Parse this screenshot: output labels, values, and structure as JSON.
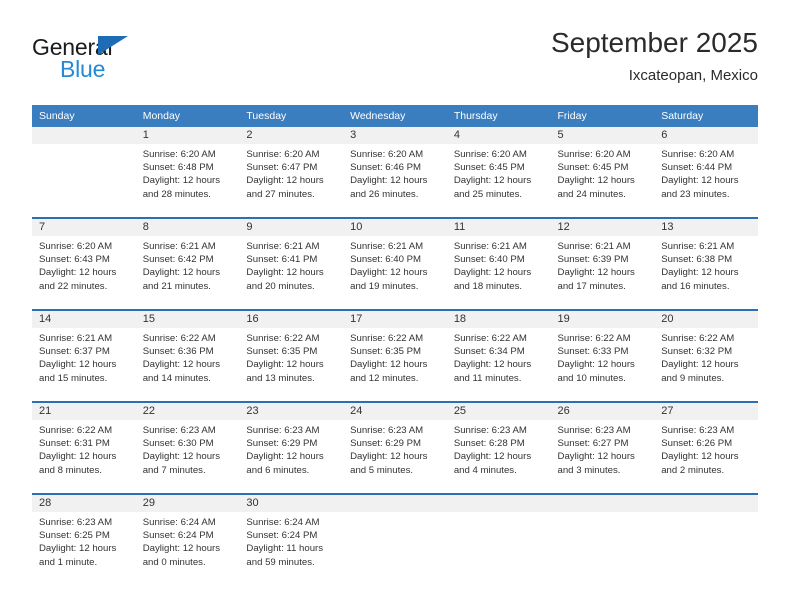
{
  "brand": {
    "name_top": "General",
    "name_bottom": "Blue",
    "triangle_color": "#1d6cb5",
    "blue_color": "#2489d6"
  },
  "header": {
    "title": "September 2025",
    "subtitle": "Ixcateopan, Mexico"
  },
  "theme": {
    "header_bar": "#3a7ebf",
    "week_divider": "#2c6fb5",
    "daynum_bg": "#f1f1f1",
    "text": "#333333"
  },
  "labels": {
    "sunrise": "Sunrise:",
    "sunset": "Sunset:",
    "daylight": "Daylight:"
  },
  "weekdays": [
    "Sunday",
    "Monday",
    "Tuesday",
    "Wednesday",
    "Thursday",
    "Friday",
    "Saturday"
  ],
  "weeks": [
    [
      {
        "day": "",
        "sunrise": "",
        "sunset": "",
        "daylight_line1": "",
        "daylight_line2": ""
      },
      {
        "day": "1",
        "sunrise": "Sunrise: 6:20 AM",
        "sunset": "Sunset: 6:48 PM",
        "daylight_line1": "Daylight: 12 hours",
        "daylight_line2": "and 28 minutes."
      },
      {
        "day": "2",
        "sunrise": "Sunrise: 6:20 AM",
        "sunset": "Sunset: 6:47 PM",
        "daylight_line1": "Daylight: 12 hours",
        "daylight_line2": "and 27 minutes."
      },
      {
        "day": "3",
        "sunrise": "Sunrise: 6:20 AM",
        "sunset": "Sunset: 6:46 PM",
        "daylight_line1": "Daylight: 12 hours",
        "daylight_line2": "and 26 minutes."
      },
      {
        "day": "4",
        "sunrise": "Sunrise: 6:20 AM",
        "sunset": "Sunset: 6:45 PM",
        "daylight_line1": "Daylight: 12 hours",
        "daylight_line2": "and 25 minutes."
      },
      {
        "day": "5",
        "sunrise": "Sunrise: 6:20 AM",
        "sunset": "Sunset: 6:45 PM",
        "daylight_line1": "Daylight: 12 hours",
        "daylight_line2": "and 24 minutes."
      },
      {
        "day": "6",
        "sunrise": "Sunrise: 6:20 AM",
        "sunset": "Sunset: 6:44 PM",
        "daylight_line1": "Daylight: 12 hours",
        "daylight_line2": "and 23 minutes."
      }
    ],
    [
      {
        "day": "7",
        "sunrise": "Sunrise: 6:20 AM",
        "sunset": "Sunset: 6:43 PM",
        "daylight_line1": "Daylight: 12 hours",
        "daylight_line2": "and 22 minutes."
      },
      {
        "day": "8",
        "sunrise": "Sunrise: 6:21 AM",
        "sunset": "Sunset: 6:42 PM",
        "daylight_line1": "Daylight: 12 hours",
        "daylight_line2": "and 21 minutes."
      },
      {
        "day": "9",
        "sunrise": "Sunrise: 6:21 AM",
        "sunset": "Sunset: 6:41 PM",
        "daylight_line1": "Daylight: 12 hours",
        "daylight_line2": "and 20 minutes."
      },
      {
        "day": "10",
        "sunrise": "Sunrise: 6:21 AM",
        "sunset": "Sunset: 6:40 PM",
        "daylight_line1": "Daylight: 12 hours",
        "daylight_line2": "and 19 minutes."
      },
      {
        "day": "11",
        "sunrise": "Sunrise: 6:21 AM",
        "sunset": "Sunset: 6:40 PM",
        "daylight_line1": "Daylight: 12 hours",
        "daylight_line2": "and 18 minutes."
      },
      {
        "day": "12",
        "sunrise": "Sunrise: 6:21 AM",
        "sunset": "Sunset: 6:39 PM",
        "daylight_line1": "Daylight: 12 hours",
        "daylight_line2": "and 17 minutes."
      },
      {
        "day": "13",
        "sunrise": "Sunrise: 6:21 AM",
        "sunset": "Sunset: 6:38 PM",
        "daylight_line1": "Daylight: 12 hours",
        "daylight_line2": "and 16 minutes."
      }
    ],
    [
      {
        "day": "14",
        "sunrise": "Sunrise: 6:21 AM",
        "sunset": "Sunset: 6:37 PM",
        "daylight_line1": "Daylight: 12 hours",
        "daylight_line2": "and 15 minutes."
      },
      {
        "day": "15",
        "sunrise": "Sunrise: 6:22 AM",
        "sunset": "Sunset: 6:36 PM",
        "daylight_line1": "Daylight: 12 hours",
        "daylight_line2": "and 14 minutes."
      },
      {
        "day": "16",
        "sunrise": "Sunrise: 6:22 AM",
        "sunset": "Sunset: 6:35 PM",
        "daylight_line1": "Daylight: 12 hours",
        "daylight_line2": "and 13 minutes."
      },
      {
        "day": "17",
        "sunrise": "Sunrise: 6:22 AM",
        "sunset": "Sunset: 6:35 PM",
        "daylight_line1": "Daylight: 12 hours",
        "daylight_line2": "and 12 minutes."
      },
      {
        "day": "18",
        "sunrise": "Sunrise: 6:22 AM",
        "sunset": "Sunset: 6:34 PM",
        "daylight_line1": "Daylight: 12 hours",
        "daylight_line2": "and 11 minutes."
      },
      {
        "day": "19",
        "sunrise": "Sunrise: 6:22 AM",
        "sunset": "Sunset: 6:33 PM",
        "daylight_line1": "Daylight: 12 hours",
        "daylight_line2": "and 10 minutes."
      },
      {
        "day": "20",
        "sunrise": "Sunrise: 6:22 AM",
        "sunset": "Sunset: 6:32 PM",
        "daylight_line1": "Daylight: 12 hours",
        "daylight_line2": "and 9 minutes."
      }
    ],
    [
      {
        "day": "21",
        "sunrise": "Sunrise: 6:22 AM",
        "sunset": "Sunset: 6:31 PM",
        "daylight_line1": "Daylight: 12 hours",
        "daylight_line2": "and 8 minutes."
      },
      {
        "day": "22",
        "sunrise": "Sunrise: 6:23 AM",
        "sunset": "Sunset: 6:30 PM",
        "daylight_line1": "Daylight: 12 hours",
        "daylight_line2": "and 7 minutes."
      },
      {
        "day": "23",
        "sunrise": "Sunrise: 6:23 AM",
        "sunset": "Sunset: 6:29 PM",
        "daylight_line1": "Daylight: 12 hours",
        "daylight_line2": "and 6 minutes."
      },
      {
        "day": "24",
        "sunrise": "Sunrise: 6:23 AM",
        "sunset": "Sunset: 6:29 PM",
        "daylight_line1": "Daylight: 12 hours",
        "daylight_line2": "and 5 minutes."
      },
      {
        "day": "25",
        "sunrise": "Sunrise: 6:23 AM",
        "sunset": "Sunset: 6:28 PM",
        "daylight_line1": "Daylight: 12 hours",
        "daylight_line2": "and 4 minutes."
      },
      {
        "day": "26",
        "sunrise": "Sunrise: 6:23 AM",
        "sunset": "Sunset: 6:27 PM",
        "daylight_line1": "Daylight: 12 hours",
        "daylight_line2": "and 3 minutes."
      },
      {
        "day": "27",
        "sunrise": "Sunrise: 6:23 AM",
        "sunset": "Sunset: 6:26 PM",
        "daylight_line1": "Daylight: 12 hours",
        "daylight_line2": "and 2 minutes."
      }
    ],
    [
      {
        "day": "28",
        "sunrise": "Sunrise: 6:23 AM",
        "sunset": "Sunset: 6:25 PM",
        "daylight_line1": "Daylight: 12 hours",
        "daylight_line2": "and 1 minute."
      },
      {
        "day": "29",
        "sunrise": "Sunrise: 6:24 AM",
        "sunset": "Sunset: 6:24 PM",
        "daylight_line1": "Daylight: 12 hours",
        "daylight_line2": "and 0 minutes."
      },
      {
        "day": "30",
        "sunrise": "Sunrise: 6:24 AM",
        "sunset": "Sunset: 6:24 PM",
        "daylight_line1": "Daylight: 11 hours",
        "daylight_line2": "and 59 minutes."
      },
      {
        "day": "",
        "sunrise": "",
        "sunset": "",
        "daylight_line1": "",
        "daylight_line2": ""
      },
      {
        "day": "",
        "sunrise": "",
        "sunset": "",
        "daylight_line1": "",
        "daylight_line2": ""
      },
      {
        "day": "",
        "sunrise": "",
        "sunset": "",
        "daylight_line1": "",
        "daylight_line2": ""
      },
      {
        "day": "",
        "sunrise": "",
        "sunset": "",
        "daylight_line1": "",
        "daylight_line2": ""
      }
    ]
  ]
}
